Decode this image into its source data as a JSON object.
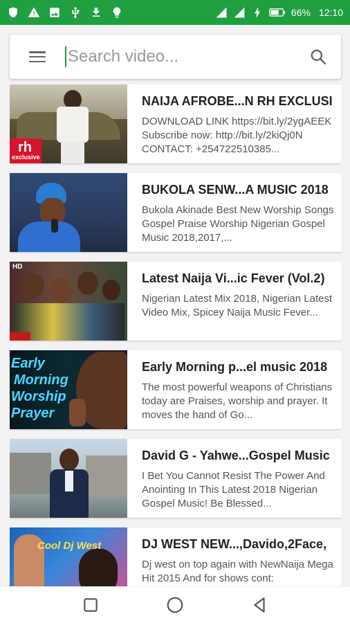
{
  "status_bar": {
    "battery": "66%",
    "time": "12:10",
    "left_icons": [
      "shield-icon",
      "warning-icon",
      "image-icon",
      "usb-icon",
      "download-icon",
      "bulb-icon"
    ],
    "right_icons": [
      "signal-icon",
      "signal-4g-icon",
      "charging-icon",
      "battery-icon"
    ]
  },
  "search": {
    "placeholder": "Search video..."
  },
  "videos": [
    {
      "title": "NAIJA AFROBE...N RH EXCLUSI",
      "description": "DOWNLOAD LINK https://bit.ly/2ygAEEK Subscribe now: http://bit.ly/2kiQj0N CONTACT: +254722510385...",
      "thumb_text_1": "rh",
      "thumb_text_2": "exclusive"
    },
    {
      "title": "BUKOLA SENW...A MUSIC 2018",
      "description": "Bukola Akinade Best New Worship Songs Gospel Praise Worship Nigerian Gospel Music 2018,2017,..."
    },
    {
      "title": "Latest Naija Vi...ic Fever (Vol.2)",
      "description": "Nigerian Latest Mix 2018, Nigerian Latest Video Mix, Spicey Naija Music Fever...",
      "thumb_text_1": "HD"
    },
    {
      "title": "Early Morning p...el music 2018",
      "description": "The most powerful weapons of Christians today are Praises, worship and prayer. It moves the hand of Go...",
      "thumb_text_1": "Early",
      "thumb_text_2": "Morning",
      "thumb_text_3": "Worship",
      "thumb_text_4": "Prayer"
    },
    {
      "title": "David G - Yahwe...Gospel Music",
      "description": "I Bet You Cannot Resist The Power And Anointing In This Latest 2018 Nigerian Gospel Music! Be Blessed..."
    },
    {
      "title": "DJ WEST NEW...,Davido,2Face,",
      "description": "Dj west on top again with NewNaija Mega Hit 2015 And for shows cont:",
      "thumb_text_1": "Cool Dj West"
    }
  ],
  "nav": {
    "icons": [
      "recent-apps-icon",
      "home-icon",
      "back-icon"
    ]
  },
  "colors": {
    "status_bar": "#1f9f3f",
    "accent": "#1f9f3f"
  }
}
